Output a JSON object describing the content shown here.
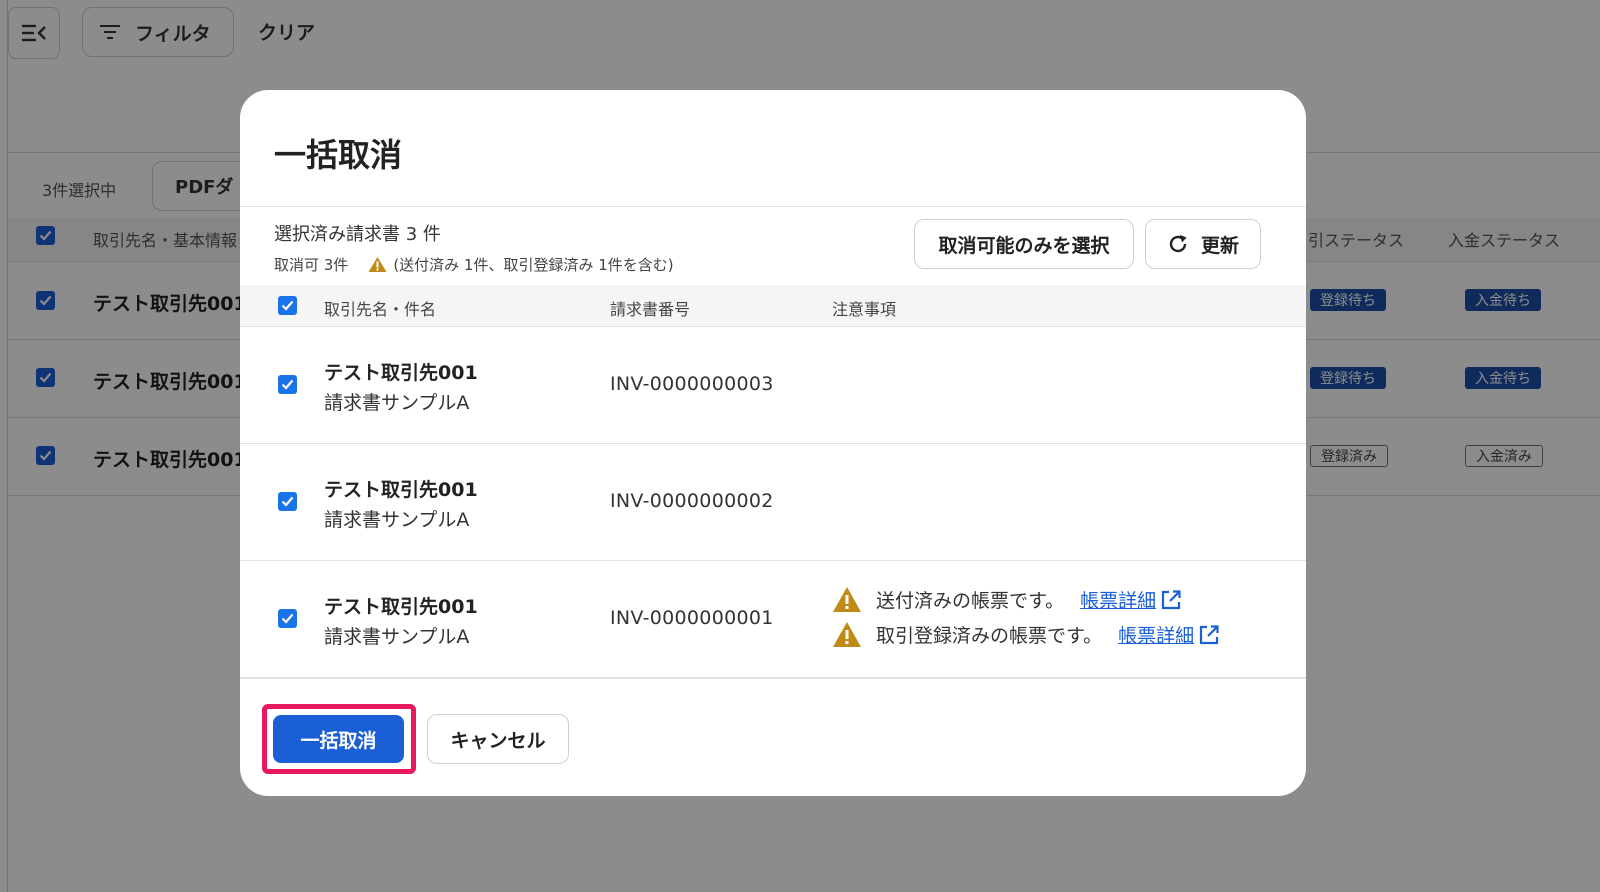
{
  "background": {
    "toolbar": {
      "menu_icon": "menu-collapse-icon",
      "filter_label": "フィルタ",
      "clear_label": "クリア"
    },
    "selection": {
      "count_label": "3件選択中",
      "pdf_label": "PDFダ"
    },
    "table": {
      "col_name": "取引先名・基本情報",
      "col_trade_status": "引ステータス",
      "col_payment_status": "入金ステータス",
      "rows": [
        {
          "name": "テスト取引先001",
          "trade_status": "登録待ち",
          "payment_status": "入金待ち"
        },
        {
          "name": "テスト取引先001",
          "trade_status": "登録待ち",
          "payment_status": "入金待ち"
        },
        {
          "name": "テスト取引先001",
          "trade_status": "登録済み",
          "payment_status": "入金済み"
        }
      ]
    }
  },
  "modal": {
    "title": "一括取消",
    "summary": {
      "title": "選択済み請求書 3 件",
      "cancellable": "取消可 3件",
      "warning_note": "(送付済み 1件、取引登録済み 1件を含む)"
    },
    "actions": {
      "select_only_label": "取消可能のみを選択",
      "refresh_label": "更新"
    },
    "table": {
      "col_name": "取引先名・件名",
      "col_invoice": "請求書番号",
      "col_notes": "注意事項",
      "rows": [
        {
          "name": "テスト取引先001",
          "subject": "請求書サンプルA",
          "invoice_no": "INV-0000000003",
          "notes": []
        },
        {
          "name": "テスト取引先001",
          "subject": "請求書サンプルA",
          "invoice_no": "INV-0000000002",
          "notes": []
        },
        {
          "name": "テスト取引先001",
          "subject": "請求書サンプルA",
          "invoice_no": "INV-0000000001",
          "notes": [
            {
              "text": "送付済みの帳票です。",
              "link": "帳票詳細"
            },
            {
              "text": "取引登録済みの帳票です。",
              "link": "帳票詳細"
            }
          ]
        }
      ]
    },
    "footer": {
      "primary_label": "一括取消",
      "cancel_label": "キャンセル"
    }
  },
  "colors": {
    "primary": "#1a5fd6",
    "highlight": "#e8185e",
    "warning": "#c08a16"
  }
}
